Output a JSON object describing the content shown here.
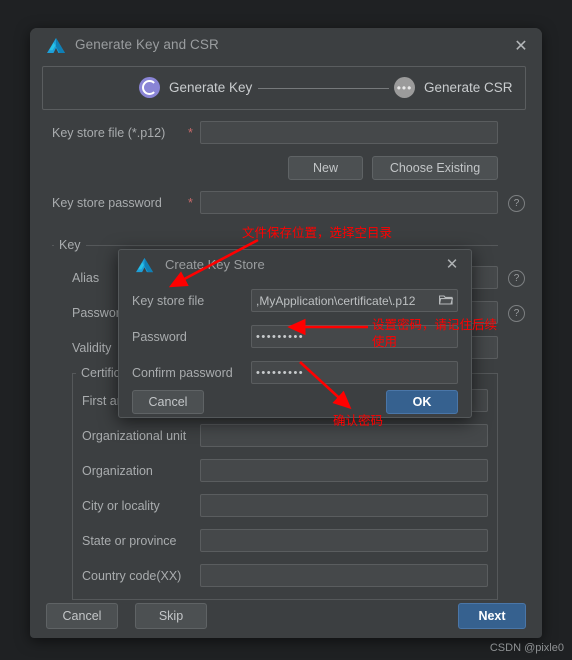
{
  "window": {
    "title": "Generate Key and CSR",
    "app_icon": "android-studio-icon",
    "close_icon": "close-icon"
  },
  "steps": {
    "active": {
      "label": "Generate Key",
      "icon": "progress-ring-icon"
    },
    "next": {
      "label": "Generate CSR",
      "icon": "ellipsis-icon"
    }
  },
  "keystore": {
    "file_label": "Key store file (*.p12)",
    "file_required": "*",
    "file_value": "",
    "new_button": "New",
    "choose_existing_button": "Choose Existing",
    "password_label": "Key store password",
    "password_required": "*",
    "password_value": "",
    "help_icon": "?"
  },
  "key_group": {
    "legend": "Key",
    "alias_label": "Alias",
    "alias_value": "",
    "password_label": "Password",
    "password_value": "",
    "validity_label": "Validity",
    "validity_value": "",
    "help_icon": "?"
  },
  "certificate_group": {
    "legend": "Certificate",
    "fields": [
      {
        "label": "First and last name",
        "value": ""
      },
      {
        "label": "Organizational unit",
        "value": ""
      },
      {
        "label": "Organization",
        "value": ""
      },
      {
        "label": "City or locality",
        "value": ""
      },
      {
        "label": "State or province",
        "value": ""
      },
      {
        "label": "Country code(XX)",
        "value": ""
      }
    ]
  },
  "footer": {
    "cancel": "Cancel",
    "skip": "Skip",
    "next": "Next"
  },
  "modal": {
    "title": "Create Key Store",
    "app_icon": "android-studio-icon",
    "close_icon": "close-icon",
    "file_label": "Key store file",
    "file_value": ",MyApplication\\certificate\\.p12",
    "browse_icon": "folder-icon",
    "password_label": "Password",
    "password_value": "•••••••••",
    "confirm_label": "Confirm password",
    "confirm_value": "•••••••••",
    "cancel": "Cancel",
    "ok": "OK"
  },
  "annotations": [
    {
      "text": "文件保存位置，选择空目录"
    },
    {
      "text": "设置密码，请记住后续\n使用"
    },
    {
      "text": "确认密码"
    }
  ],
  "watermark": "CSDN @pixle0",
  "colors": {
    "window_bg": "#3c3f41",
    "field_bg": "#45484a",
    "accent_blue": "#36618f",
    "step_purple": "#8a85d6",
    "annotation_red": "#ff0000",
    "required_red": "#c86a6a"
  }
}
